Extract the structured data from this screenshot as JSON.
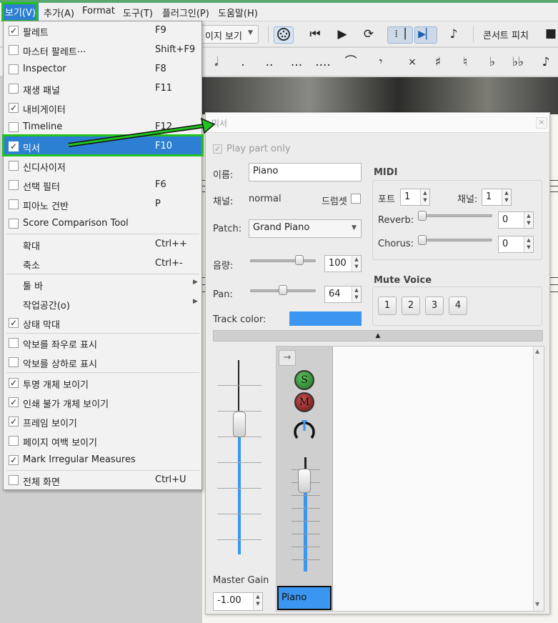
{
  "menubar": {
    "items": [
      "보기(V)",
      "추가(A)",
      "Format",
      "도구(T)",
      "플러그인(P)",
      "도움말(H)"
    ]
  },
  "toolbar": {
    "view_mode": "이지 보기",
    "concert_pitch": "콘서트 피치"
  },
  "view_menu": {
    "items": [
      {
        "label": "팔레트",
        "shortcut": "F9",
        "checked": true
      },
      {
        "label": "마스터 팔레트···",
        "shortcut": "Shift+F9",
        "checked": false
      },
      {
        "label": "Inspector",
        "shortcut": "F8",
        "checked": false
      },
      {
        "label": "재생 패널",
        "shortcut": "F11",
        "checked": false
      },
      {
        "label": "내비게이터",
        "shortcut": "",
        "checked": true
      },
      {
        "label": "Timeline",
        "shortcut": "F12",
        "checked": false
      },
      {
        "label": "믹서",
        "shortcut": "F10",
        "checked": true
      },
      {
        "label": "신디사이저",
        "shortcut": "",
        "checked": false
      },
      {
        "label": "선택 필터",
        "shortcut": "F6",
        "checked": false
      },
      {
        "label": "피아노 건반",
        "shortcut": "P",
        "checked": false
      },
      {
        "label": "Score Comparison Tool",
        "shortcut": "",
        "checked": false
      },
      {
        "label": "확대",
        "shortcut": "Ctrl++"
      },
      {
        "label": "축소",
        "shortcut": "Ctrl+-"
      },
      {
        "label": "툴 바",
        "shortcut": ""
      },
      {
        "label": "작업공간(o)",
        "shortcut": ""
      },
      {
        "label": "상태 막대",
        "shortcut": "",
        "checked": true
      },
      {
        "label": "악보를 좌우로 표시",
        "shortcut": "",
        "checked": false
      },
      {
        "label": "악보를 상하로 표시",
        "shortcut": "",
        "checked": false
      },
      {
        "label": "투명 개체 보이기",
        "shortcut": "",
        "checked": true
      },
      {
        "label": "인쇄 불가 개체 보이기",
        "shortcut": "",
        "checked": true
      },
      {
        "label": "프레임 보이기",
        "shortcut": "",
        "checked": true
      },
      {
        "label": "페이지 여백 보이기",
        "shortcut": "",
        "checked": false
      },
      {
        "label": "Mark Irregular Measures",
        "shortcut": "",
        "checked": true
      },
      {
        "label": "전체 화면",
        "shortcut": "Ctrl+U",
        "checked": false
      }
    ]
  },
  "mixer": {
    "title": "믹서",
    "play_part_only": "Play part only",
    "name_label": "이름:",
    "name_value": "Piano",
    "channel_label": "채널:",
    "channel_value": "normal",
    "drumset_label": "드럼셋",
    "patch_label": "Patch:",
    "patch_value": "Grand Piano",
    "volume_label": "음량:",
    "volume_value": "100",
    "pan_label": "Pan:",
    "pan_value": "64",
    "track_color_label": "Track color:",
    "track_color": "#3a96f0",
    "midi": {
      "title": "MIDI",
      "port_label": "포트",
      "port_value": "1",
      "channel_label": "채널:",
      "channel_value": "1",
      "reverb_label": "Reverb:",
      "reverb_value": "0",
      "chorus_label": "Chorus:",
      "chorus_value": "0"
    },
    "mute_voice": {
      "title": "Mute Voice",
      "voices": [
        "1",
        "2",
        "3",
        "4"
      ]
    },
    "strip": {
      "solo": "S",
      "mute": "M",
      "name": "Piano"
    },
    "master_gain_label": "Master Gain",
    "master_gain_value": "-1.00"
  },
  "colors": {
    "highlight": "#2d7fd3",
    "annotation": "#22c21f"
  }
}
